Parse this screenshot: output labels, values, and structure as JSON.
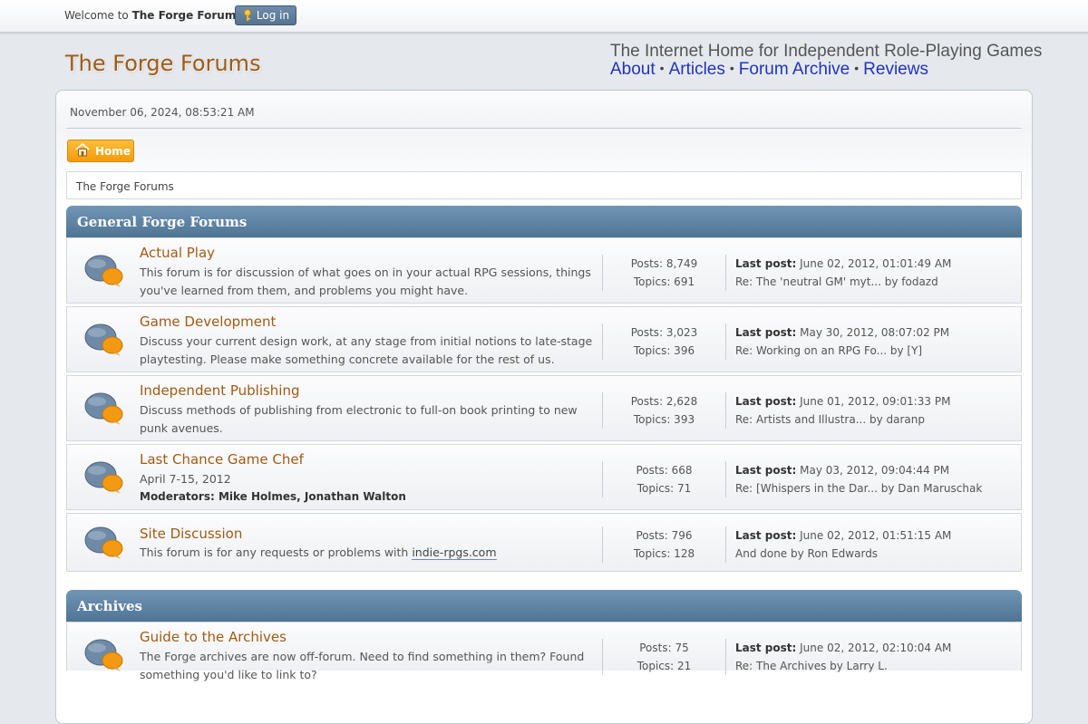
{
  "topbar": {
    "welcome_prefix": "Welcome to ",
    "site_name": "The Forge Forums",
    "welcome_suffix": ".",
    "login_label": "Log in"
  },
  "header": {
    "site_title": "The Forge Forums",
    "tagline": "The Internet Home for Independent Role-Playing Games",
    "nav": [
      "About",
      "Articles",
      "Forum Archive",
      "Reviews"
    ]
  },
  "date": "November 06, 2024, 08:53:21 AM",
  "home_label": "Home",
  "breadcrumb": "The Forge Forums",
  "categories": [
    {
      "title": "General Forge Forums",
      "boards": [
        {
          "name": "Actual Play",
          "desc": "This forum is for discussion of what goes on in your actual RPG sessions, things you've learned from them, and problems you might have.",
          "posts": "Posts: 8,749",
          "topics": "Topics: 691",
          "last_label": "Last post:",
          "last_date": " June 02, 2012, 01:01:49 AM",
          "last_topic": "Re: The 'neutral GM' myt... by fodazd"
        },
        {
          "name": "Game Development",
          "desc": "Discuss your current design work, at any stage from initial notions to late-stage  playtesting. Please make something concrete available for the rest of us.",
          "posts": "Posts: 3,023",
          "topics": "Topics: 396",
          "last_label": "Last post:",
          "last_date": " May 30, 2012, 08:07:02 PM",
          "last_topic": "Re: Working on an RPG Fo... by [Y]"
        },
        {
          "name": "Independent Publishing",
          "desc": "Discuss methods of publishing from electronic to full-on book printing to new punk avenues.",
          "posts": "Posts: 2,628",
          "topics": "Topics: 393",
          "last_label": "Last post:",
          "last_date": " June 01, 2012, 09:01:33 PM",
          "last_topic": "Re: Artists and Illustra... by daranp"
        },
        {
          "name": "Last Chance Game Chef",
          "desc": "April 7-15, 2012",
          "mods": "Moderators: Mike Holmes, Jonathan Walton",
          "posts": "Posts: 668",
          "topics": "Topics: 71",
          "last_label": "Last post:",
          "last_date": " May 03, 2012, 09:04:44 PM",
          "last_topic": "Re: [Whispers in the Dar... by Dan Maruschak"
        },
        {
          "name": "Site Discussion",
          "desc": "This forum is for any requests or problems with ",
          "desc_link": "indie-rpgs.com",
          "posts": "Posts: 796",
          "topics": "Topics: 128",
          "last_label": "Last post:",
          "last_date": " June 02, 2012, 01:51:15 AM",
          "last_topic": "And done by Ron Edwards"
        }
      ]
    },
    {
      "title": "Archives",
      "boards": [
        {
          "name": "Guide to the Archives",
          "desc": "The Forge archives are now off-forum. Need to find something in them? Found something you'd like to link to?",
          "posts": "Posts: 75",
          "topics": "Topics: 21",
          "last_label": "Last post:",
          "last_date": " June 02, 2012, 02:10:04 AM",
          "last_topic": "Re: The Archives by Larry L."
        }
      ]
    }
  ],
  "colors": {
    "brand": "#a15a14",
    "header_blue": "#4f7494",
    "home_orange": "#f49b0b",
    "link_blue": "#2233bb"
  }
}
